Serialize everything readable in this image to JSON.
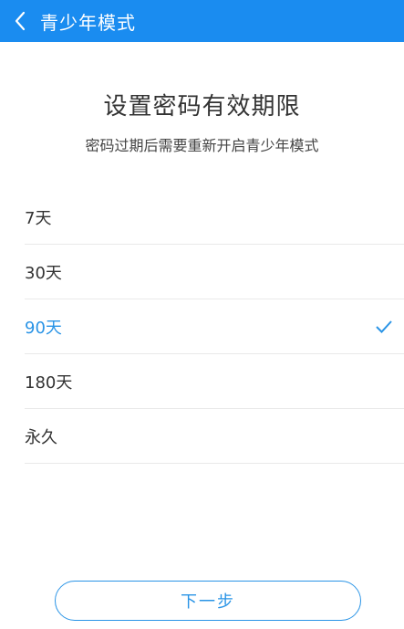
{
  "header": {
    "title": "青少年模式"
  },
  "main": {
    "heading": "设置密码有效期限",
    "subheading": "密码过期后需要重新开启青少年模式",
    "options": [
      {
        "label": "7天",
        "selected": false
      },
      {
        "label": "30天",
        "selected": false
      },
      {
        "label": "90天",
        "selected": true
      },
      {
        "label": "180天",
        "selected": false
      },
      {
        "label": "永久",
        "selected": false
      }
    ],
    "next_label": "下一步"
  },
  "colors": {
    "header_bg": "#1a8cf0",
    "accent": "#2a94e6"
  },
  "icons": {
    "back": "chevron-left-icon",
    "check": "check-icon"
  }
}
